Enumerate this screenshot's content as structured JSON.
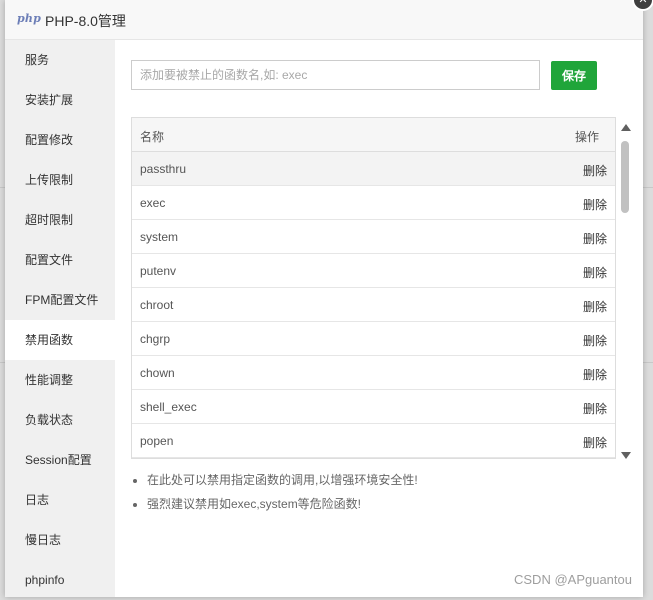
{
  "window": {
    "logo_text": "php",
    "title": "PHP-8.0管理",
    "close_symbol": "✕"
  },
  "sidebar": {
    "items": [
      {
        "label": "服务"
      },
      {
        "label": "安装扩展"
      },
      {
        "label": "配置修改"
      },
      {
        "label": "上传限制"
      },
      {
        "label": "超时限制"
      },
      {
        "label": "配置文件"
      },
      {
        "label": "FPM配置文件"
      },
      {
        "label": "禁用函数"
      },
      {
        "label": "性能调整"
      },
      {
        "label": "负载状态"
      },
      {
        "label": "Session配置"
      },
      {
        "label": "日志"
      },
      {
        "label": "慢日志"
      },
      {
        "label": "phpinfo"
      }
    ],
    "active_label": "禁用函数"
  },
  "form": {
    "input_value": "",
    "input_placeholder": "添加要被禁止的函数名,如: exec",
    "save_label": "保存"
  },
  "table": {
    "columns": {
      "name": "名称",
      "action": "操作"
    },
    "delete_label": "删除",
    "rows": [
      {
        "name": "passthru"
      },
      {
        "name": "exec"
      },
      {
        "name": "system"
      },
      {
        "name": "putenv"
      },
      {
        "name": "chroot"
      },
      {
        "name": "chgrp"
      },
      {
        "name": "chown"
      },
      {
        "name": "shell_exec"
      },
      {
        "name": "popen"
      }
    ]
  },
  "tips": [
    "在此处可以禁用指定函数的调用,以增强环境安全性!",
    "强烈建议禁用如exec,system等危险函数!"
  ],
  "watermark": "CSDN @APguantou",
  "colors": {
    "accent_green": "#20a53a",
    "sidebar_bg": "#f0f0f0",
    "title_bg": "#f8f8f8"
  }
}
